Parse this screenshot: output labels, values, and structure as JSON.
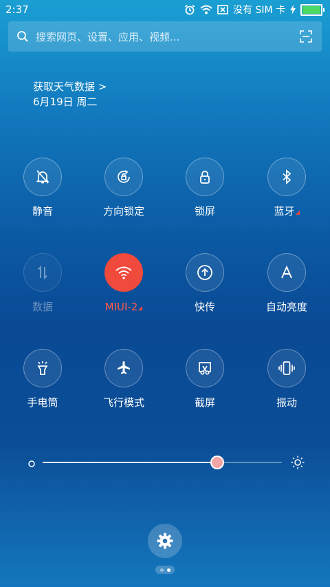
{
  "status_bar": {
    "time": "2:37",
    "no_sim": "没有 SIM 卡",
    "battery_level": 1.0,
    "icons": [
      "alarm-icon",
      "wifi-icon",
      "no-sim-icon",
      "charging-icon",
      "battery-icon"
    ]
  },
  "search": {
    "placeholder": "搜索网页、设置、应用、视频...",
    "icon": "search-icon",
    "scan_icon": "scan-icon"
  },
  "weather": {
    "link": "获取天气数据 >",
    "date": "6月19日 周二"
  },
  "tiles": [
    {
      "label": "静音",
      "icon": "bell-off-icon",
      "state": "off"
    },
    {
      "label": "方向锁定",
      "icon": "rotation-lock-icon",
      "state": "off"
    },
    {
      "label": "锁屏",
      "icon": "lock-icon",
      "state": "off"
    },
    {
      "label": "蓝牙",
      "icon": "bluetooth-icon",
      "state": "off",
      "has_more": true
    },
    {
      "label": "数据",
      "icon": "data-arrows-icon",
      "state": "disabled"
    },
    {
      "label": "MIUI-2",
      "icon": "wifi-icon",
      "state": "on",
      "has_more": true
    },
    {
      "label": "快传",
      "icon": "upload-icon",
      "state": "off"
    },
    {
      "label": "自动亮度",
      "icon": "auto-brightness-icon",
      "state": "off"
    },
    {
      "label": "手电筒",
      "icon": "flashlight-icon",
      "state": "off"
    },
    {
      "label": "飞行模式",
      "icon": "airplane-icon",
      "state": "off"
    },
    {
      "label": "截屏",
      "icon": "screenshot-icon",
      "state": "off"
    },
    {
      "label": "振动",
      "icon": "vibrate-icon",
      "state": "off"
    }
  ],
  "brightness": {
    "level": 0.73
  },
  "colors": {
    "active": "#ef4a3c",
    "battery": "#4cd964"
  },
  "pager": {
    "pages": 2,
    "current": 2
  }
}
